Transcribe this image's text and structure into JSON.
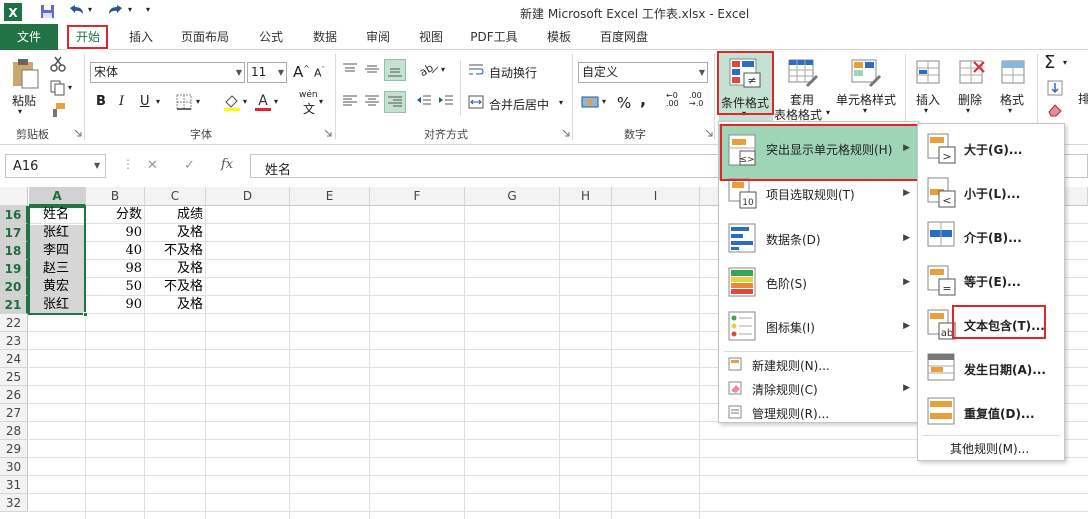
{
  "window": {
    "title": "新建 Microsoft Excel 工作表.xlsx - Excel"
  },
  "tabs": [
    "文件",
    "开始",
    "插入",
    "页面布局",
    "公式",
    "数据",
    "审阅",
    "视图",
    "PDF工具",
    "模板",
    "百度网盘"
  ],
  "ribbon": {
    "clipboard": {
      "paste": "粘贴",
      "group": "剪贴板"
    },
    "font": {
      "name": "宋体",
      "size": "11",
      "bold": "B",
      "italic": "I",
      "underline": "U",
      "wen": "wén",
      "group": "字体"
    },
    "align": {
      "wrap": "自动换行",
      "merge": "合并后居中",
      "group": "对齐方式"
    },
    "number": {
      "format": "自定义",
      "percent": "%",
      "comma": ",",
      "group": "数字"
    },
    "styles": {
      "cond": "条件格式",
      "table1": "套用",
      "table2": "表格格式",
      "cell": "单元格样式"
    },
    "cells": {
      "insert": "插入",
      "delete": "删除",
      "format": "格式"
    },
    "right": {
      "sigma": "Σ",
      "sort": "排"
    }
  },
  "formula_bar": {
    "name_box": "A16",
    "cancel": "✕",
    "enter": "✓",
    "fx": "fx",
    "content": "姓名"
  },
  "columns": [
    "A",
    "B",
    "C",
    "D",
    "E",
    "F",
    "G",
    "H",
    "I"
  ],
  "rows": [
    "16",
    "17",
    "18",
    "19",
    "20",
    "21",
    "22",
    "23",
    "24",
    "25",
    "26",
    "27",
    "28",
    "29",
    "30",
    "31",
    "32"
  ],
  "cells": [
    [
      "姓名",
      "分数",
      "成绩"
    ],
    [
      "张红",
      "90",
      "及格"
    ],
    [
      "李四",
      "40",
      "不及格"
    ],
    [
      "赵三",
      "98",
      "及格"
    ],
    [
      "黄宏",
      "50",
      "不及格"
    ],
    [
      "张红",
      "90",
      "及格"
    ]
  ],
  "menu": {
    "items": [
      {
        "label": "突出显示单元格规则(H)",
        "arrow": "▶"
      },
      {
        "label": "项目选取规则(T)",
        "arrow": "▶"
      },
      {
        "label": "数据条(D)",
        "arrow": "▶"
      },
      {
        "label": "色阶(S)",
        "arrow": "▶"
      },
      {
        "label": "图标集(I)",
        "arrow": "▶"
      }
    ],
    "small_items": [
      {
        "label": "新建规则(N)..."
      },
      {
        "label": "清除规则(C)",
        "arrow": "▶"
      },
      {
        "label": "管理规则(R)..."
      }
    ]
  },
  "submenu": {
    "items": [
      "大于(G)...",
      "小于(L)...",
      "介于(B)...",
      "等于(E)...",
      "文本包含(T)...",
      "发生日期(A)...",
      "重复值(D)..."
    ],
    "other": "其他规则(M)..."
  },
  "colors": {
    "excel_green": "#217346",
    "highlight": "#9fd5b7",
    "red": "#e0262a",
    "row_green": "#1e6f3e"
  }
}
